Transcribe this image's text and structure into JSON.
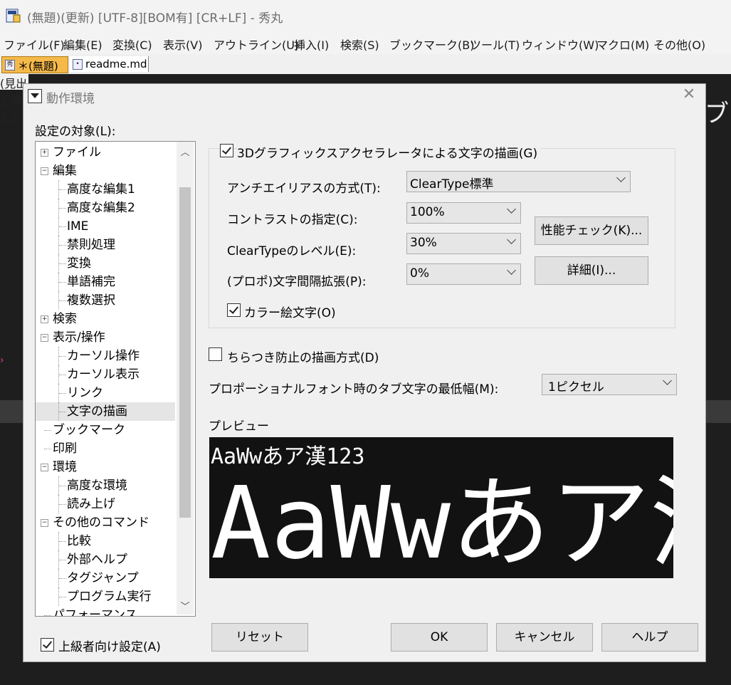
{
  "window": {
    "title": "(無題)(更新) [UTF-8][BOM有] [CR+LF] - 秀丸"
  },
  "menubar": {
    "items": [
      "ファイル(F)",
      "編集(E)",
      "変換(C)",
      "表示(V)",
      "アウトライン(U)",
      "挿入(I)",
      "検索(S)",
      "ブックマーク(B)",
      "ツール(T)",
      "ウィンドウ(W)",
      "マクロ(M)",
      "その他(O)"
    ]
  },
  "tabs": [
    {
      "label": "＊(無題)",
      "active": true
    },
    {
      "label": "readme.md",
      "active": false
    }
  ],
  "outline_strip": "(見出し無し)",
  "dialog": {
    "title": "動作環境",
    "close_glyph": "✕",
    "target_label": "設定の対象(L):",
    "tree": [
      {
        "label": "ファイル",
        "level": 0,
        "expander": "+"
      },
      {
        "label": "編集",
        "level": 0,
        "expander": "−"
      },
      {
        "label": "高度な編集1",
        "level": 1
      },
      {
        "label": "高度な編集2",
        "level": 1
      },
      {
        "label": "IME",
        "level": 1
      },
      {
        "label": "禁則処理",
        "level": 1
      },
      {
        "label": "変換",
        "level": 1
      },
      {
        "label": "単語補完",
        "level": 1
      },
      {
        "label": "複数選択",
        "level": 1
      },
      {
        "label": "検索",
        "level": 0,
        "expander": "+"
      },
      {
        "label": "表示/操作",
        "level": 0,
        "expander": "−"
      },
      {
        "label": "カーソル操作",
        "level": 1
      },
      {
        "label": "カーソル表示",
        "level": 1
      },
      {
        "label": "リンク",
        "level": 1
      },
      {
        "label": "文字の描画",
        "level": 1,
        "selected": true
      },
      {
        "label": "ブックマーク",
        "level": 0
      },
      {
        "label": "印刷",
        "level": 0
      },
      {
        "label": "環境",
        "level": 0,
        "expander": "−"
      },
      {
        "label": "高度な環境",
        "level": 1
      },
      {
        "label": "読み上げ",
        "level": 1
      },
      {
        "label": "その他のコマンド",
        "level": 0,
        "expander": "−"
      },
      {
        "label": "比較",
        "level": 1
      },
      {
        "label": "外部ヘルプ",
        "level": 1
      },
      {
        "label": "タグジャンプ",
        "level": 1
      },
      {
        "label": "プログラム実行",
        "level": 1
      },
      {
        "label": "パフォーマンス",
        "level": 0
      }
    ],
    "settings": {
      "hw_accel": {
        "label": "3Dグラフィックスアクセラレータによる文字の描画(G)",
        "checked": true
      },
      "antialias": {
        "label": "アンチエイリアスの方式(T):",
        "value": "ClearType標準"
      },
      "contrast": {
        "label": "コントラストの指定(C):",
        "value": "100%"
      },
      "cleartype_level": {
        "label": "ClearTypeのレベル(E):",
        "value": "30%"
      },
      "spacing": {
        "label": "(プロポ)文字間隔拡張(P):",
        "value": "0%"
      },
      "color_emoji": {
        "label": "カラー絵文字(O)",
        "checked": true
      },
      "perf_check_button": "性能チェック(K)...",
      "details_button": "詳細(I)...",
      "flicker": {
        "label": "ちらつき防止の描画方式(D)",
        "checked": false
      },
      "tab_min_width": {
        "label": "プロポーショナルフォント時のタブ文字の最低幅(M):",
        "value": "1ピクセル"
      }
    },
    "preview": {
      "label": "プレビュー",
      "small_text": "AaWwあア漢123",
      "large_text": "AaWwあア漢"
    },
    "advanced": {
      "label": "上級者向け設定(A)",
      "checked": true
    },
    "buttons": {
      "reset": "リセット",
      "ok": "OK",
      "cancel": "キャンセル",
      "help": "ヘルプ"
    }
  }
}
